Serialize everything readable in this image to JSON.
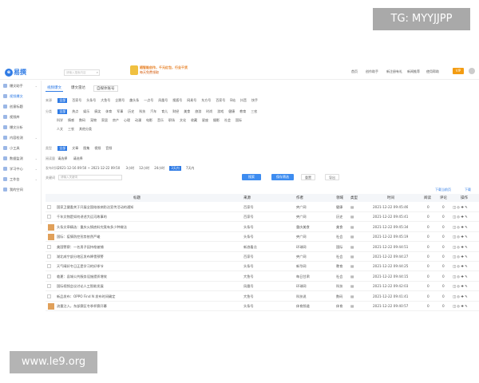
{
  "watermarks": {
    "top": "TG: MYYJJPP",
    "bottom": "www.le9.org"
  },
  "app": {
    "logo_text": "易撰",
    "search_placeholder": "请输入搜索内容"
  },
  "banner": {
    "line1": "随智能创作，千元红包，行业干货",
    "line2": "每天免费领取"
  },
  "topnav": [
    "首页",
    "创作助手",
    "新注册有礼",
    "新闻推荐",
    "使用帮助"
  ],
  "vip_label": "VIP",
  "sidebar": [
    {
      "label": "爆文助手"
    },
    {
      "label": "视频爆文"
    },
    {
      "label": "创意标题"
    },
    {
      "label": "视频库"
    },
    {
      "label": "爆文分析"
    },
    {
      "label": "内容检测"
    },
    {
      "label": "小工具"
    },
    {
      "label": "数据监测"
    },
    {
      "label": "学习中心"
    },
    {
      "label": "工作台"
    },
    {
      "label": "我的空间"
    }
  ],
  "tabs": [
    "视频爆文",
    "爆文雷达",
    "自媒体账号"
  ],
  "filters": {
    "source_label": "来源",
    "sources": [
      "全部",
      "百家号",
      "头条号",
      "大鱼号",
      "企鹅号",
      "趣头条",
      "一点号",
      "凤凰号",
      "搜狐号",
      "网易号",
      "东方号",
      "百家号",
      "B站",
      "抖音",
      "快手"
    ],
    "cat_label": "分类",
    "cats1": [
      "全部",
      "热点",
      "娱乐",
      "搞笑",
      "体育",
      "军事",
      "历史",
      "科技",
      "汽车",
      "育儿",
      "财经",
      "美食",
      "旅游",
      "时尚",
      "游戏",
      "健康",
      "教育",
      "三农"
    ],
    "cats2": [
      "科学",
      "情感",
      "数码",
      "宠物",
      "家居",
      "房产",
      "心理",
      "动漫",
      "电影",
      "音乐",
      "职场",
      "文化",
      "收藏",
      "星座",
      "摄影",
      "社会",
      "国际"
    ],
    "cats3": [
      "人文",
      "三农",
      "其他分类"
    ],
    "type_label": "类型",
    "types": [
      "全部",
      "文章",
      "图集",
      "视频",
      "音频"
    ],
    "range_label": "阅读量",
    "range_from": "请选择",
    "range_to": "请选择",
    "time_label": "发布时间",
    "time_value": "2021-12-16 09:50 ~ 2021-12-22 09:50",
    "times": [
      "3小时",
      "12小时",
      "24小时",
      "3天内",
      "7天内"
    ],
    "kw_label": "关键词",
    "kw_placeholder": "请输入关键词",
    "search_btn": "搜索",
    "reset_btn": "重置",
    "save_btn": "保存筛选",
    "export_btn": "导出"
  },
  "table": {
    "columns": [
      "标题",
      "来源",
      "作者",
      "领域",
      "类型",
      "时间",
      "阅读",
      "评论",
      "操作"
    ],
    "tools": [
      "下载当前页",
      "下载"
    ],
    "rows": [
      {
        "title": "国家卫健委关于开展全国结核病防治宣传活动的通知",
        "source": "百家号",
        "author": "央广网",
        "field": "健康",
        "time": "2021-12-22 09:45:46",
        "read": "0",
        "comment": "0"
      },
      {
        "title": "千年文物是如何讲述大运河故事的",
        "source": "百家号",
        "author": "央广网",
        "field": "历史",
        "time": "2021-12-22 09:45:41",
        "read": "0",
        "comment": "0"
      },
      {
        "title": "头条文章精选：重庆火锅底料究竟有多少种做法",
        "source": "头条号",
        "author": "重庆美食",
        "field": "美食",
        "time": "2021-12-22 09:45:34",
        "read": "0",
        "comment": "0"
      },
      {
        "title": "国际：疫情防控形势依然严峻",
        "source": "头条号",
        "author": "央广网",
        "field": "社会",
        "time": "2021-12-22 09:45:19",
        "read": "0",
        "comment": "0"
      },
      {
        "title": "美国警察：一名男子因持枪被捕",
        "source": "新浪看点",
        "author": "环球网",
        "field": "国际",
        "time": "2021-12-22 09:44:51",
        "read": "0",
        "comment": "0"
      },
      {
        "title": "湖北咸宁部分地区发布降雪预警",
        "source": "百家号",
        "author": "央广网",
        "field": "社会",
        "time": "2021-12-22 09:44:27",
        "read": "0",
        "comment": "0"
      },
      {
        "title": "天气晴好冬日正是学习的好季节",
        "source": "头条号",
        "author": "新华网",
        "field": "教育",
        "time": "2021-12-22 09:44:25",
        "read": "0",
        "comment": "0"
      },
      {
        "title": "临夏：县城公共服务设施提质增效",
        "source": "大鱼号",
        "author": "每日甘肃",
        "field": "社会",
        "time": "2021-12-22 09:44:15",
        "read": "0",
        "comment": "0"
      },
      {
        "title": "国际视频会议讨论人工智能发展",
        "source": "凤凰号",
        "author": "环球网",
        "field": "科技",
        "time": "2021-12-22 09:42:03",
        "read": "0",
        "comment": "0"
      },
      {
        "title": "新品发布：OPPO Find N 发布时间确定",
        "source": "大鱼号",
        "author": "科技说",
        "field": "数码",
        "time": "2021-12-22 09:41:41",
        "read": "0",
        "comment": "0"
      },
      {
        "title": "流量注入，东部赛区冬季杯赛开幕",
        "source": "头条号",
        "author": "体育频道",
        "field": "体育",
        "time": "2021-12-22 09:40:57",
        "read": "0",
        "comment": "0"
      }
    ]
  },
  "colors": {
    "accent": "#2f7be5",
    "vip": "#f39c12",
    "banner": "#e67e22"
  }
}
